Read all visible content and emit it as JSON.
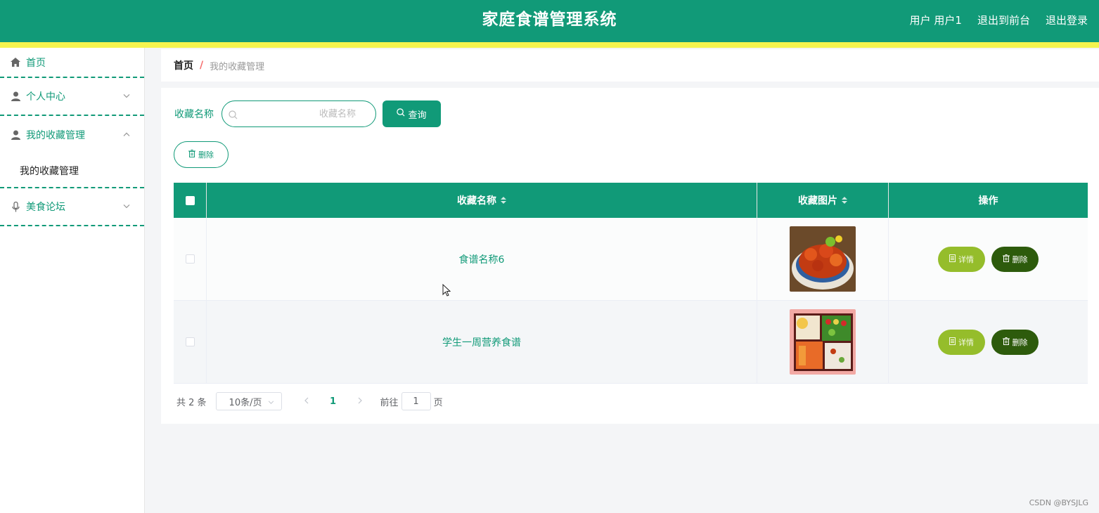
{
  "header": {
    "title": "家庭食谱管理系统",
    "user_label": "用户 用户1",
    "front_link": "退出到前台",
    "logout_link": "退出登录",
    "bg_color": "#119a78",
    "stripe_color": "#f5f44e"
  },
  "sidebar": {
    "items": [
      {
        "label": "首页",
        "icon": "home-icon"
      },
      {
        "label": "个人中心",
        "icon": "user-icon"
      },
      {
        "label": "我的收藏管理",
        "icon": "user-icon",
        "submenu": [
          "我的收藏管理"
        ]
      },
      {
        "label": "美食论坛",
        "icon": "microphone-icon"
      }
    ]
  },
  "breadcrumb": {
    "home": "首页",
    "separator": "/",
    "current": "我的收藏管理"
  },
  "search": {
    "label": "收藏名称",
    "placeholder": "收藏名称",
    "query_button": "查询"
  },
  "toolbar": {
    "delete_label": "删除"
  },
  "table": {
    "columns": [
      "收藏名称",
      "收藏图片",
      "操作"
    ],
    "rows": [
      {
        "name": "食谱名称6",
        "image": "crawfish-dish"
      },
      {
        "name": "学生一周营养食谱",
        "image": "bento-box"
      }
    ],
    "detail_label": "详情",
    "delete_label": "删除"
  },
  "pagination": {
    "total": "共 2 条",
    "page_size": "10条/页",
    "current_page": "1",
    "goto_prefix": "前往",
    "goto_value": "1",
    "goto_suffix": "页"
  },
  "watermark": "CSDN @BYSJLG"
}
